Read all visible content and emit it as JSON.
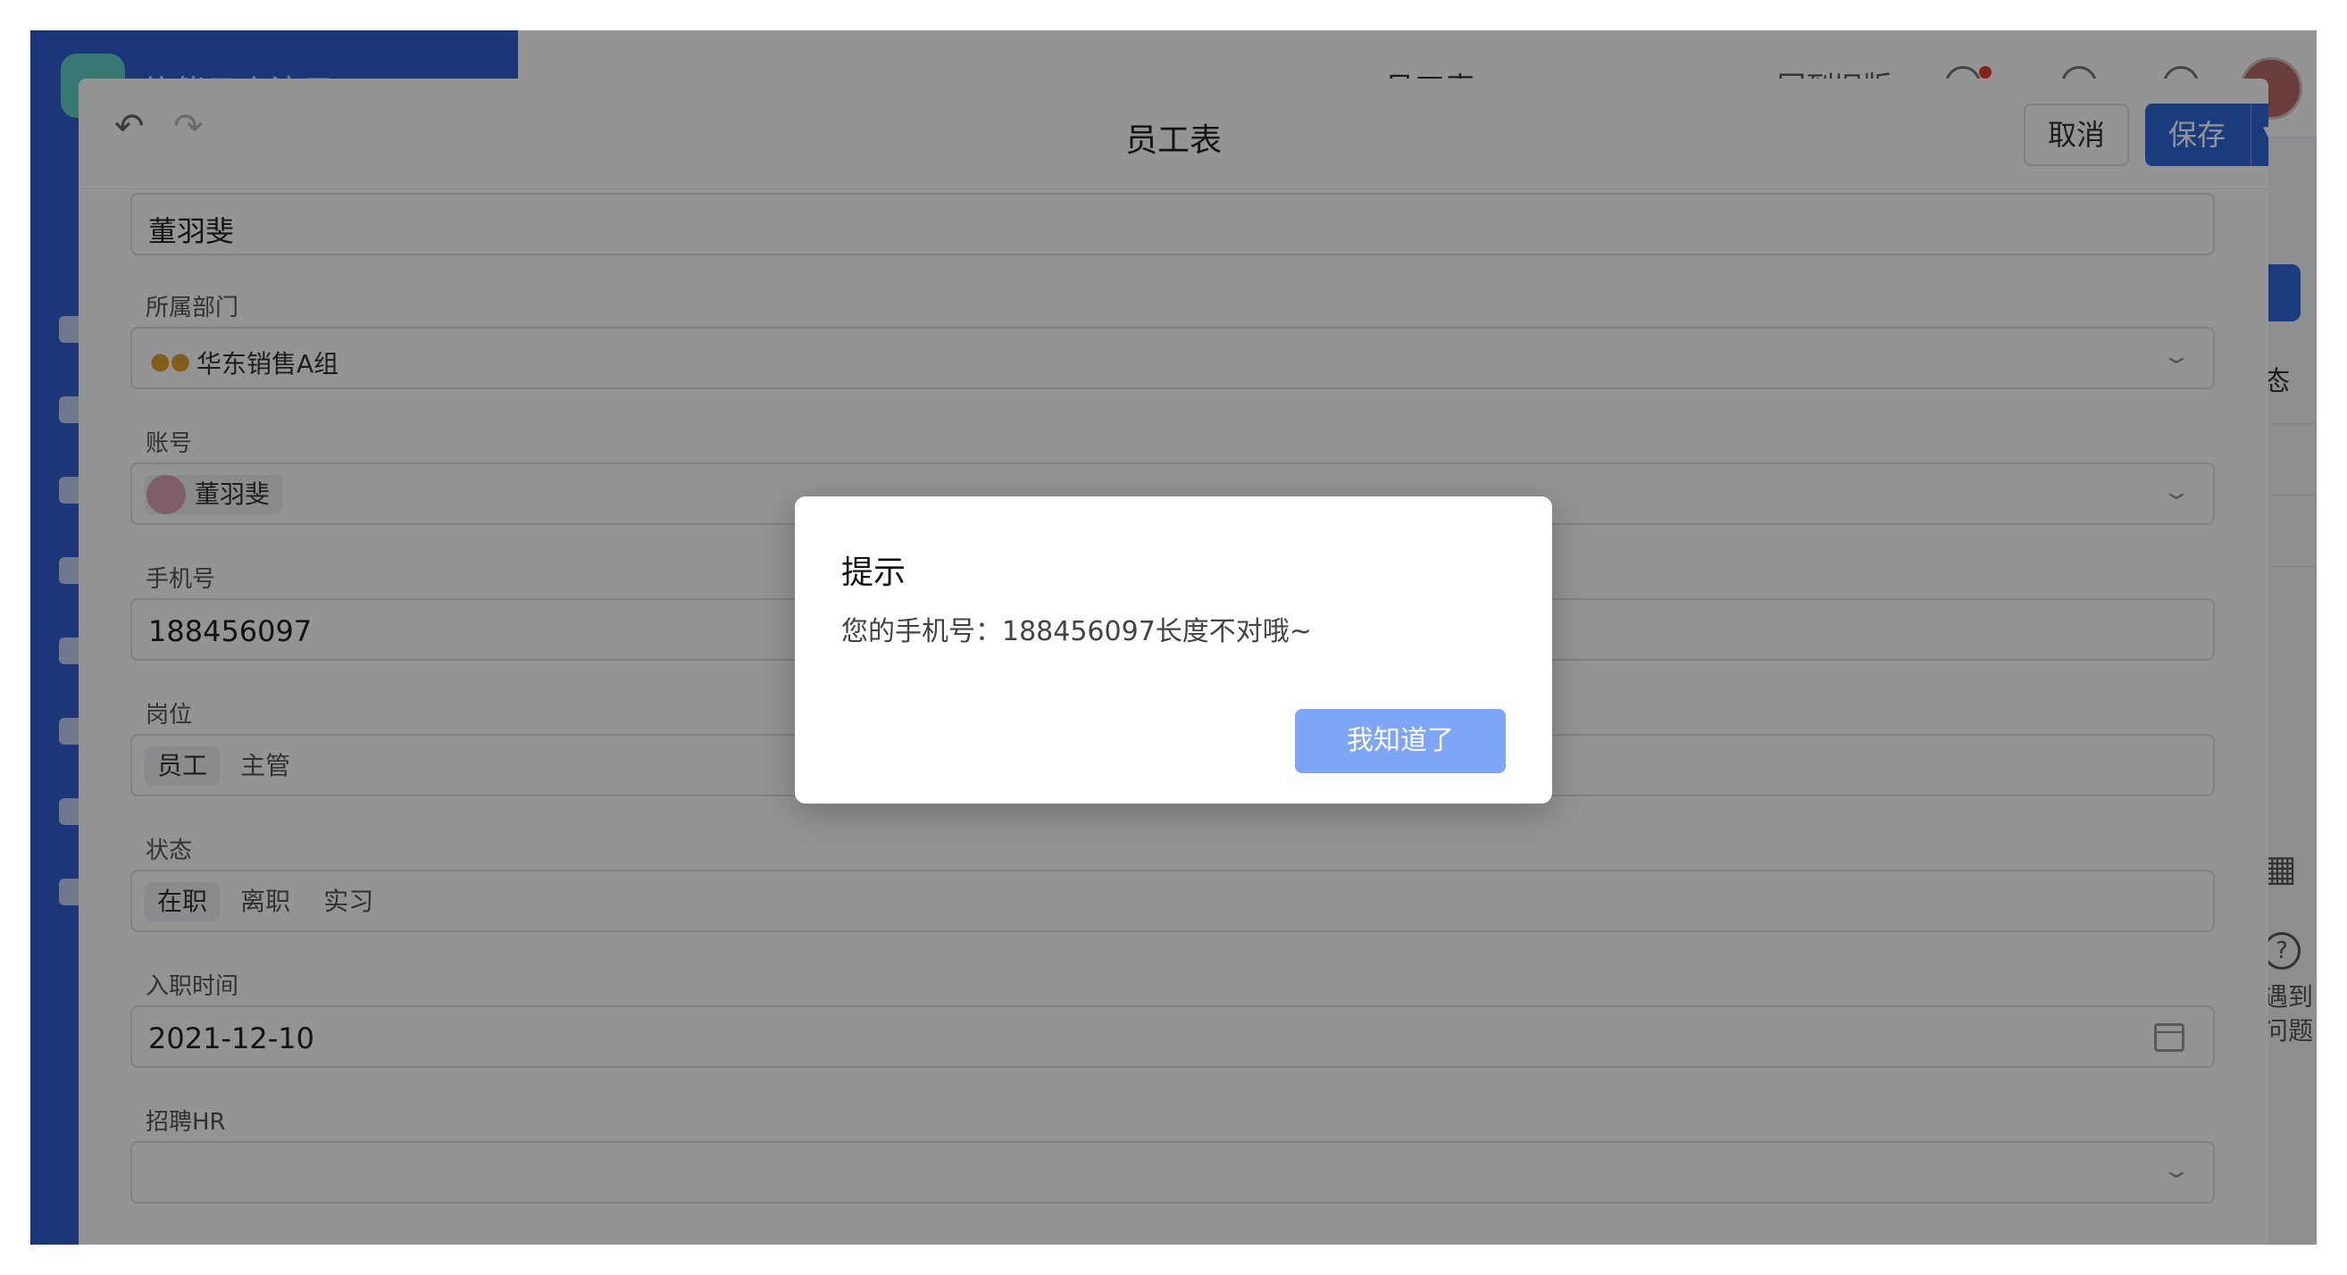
{
  "background_app": {
    "app_name": "伙伴云小演示",
    "page_title": "员工表",
    "back_link": "回到旧版",
    "right_panel_text": "态",
    "help_text": "遇到问题"
  },
  "sheet": {
    "title": "员工表",
    "cancel_label": "取消",
    "save_label": "保存",
    "fields": {
      "name": {
        "value": "董羽斐"
      },
      "department": {
        "label": "所属部门",
        "value": "华东销售A组"
      },
      "account": {
        "label": "账号",
        "value": "董羽斐"
      },
      "phone": {
        "label": "手机号",
        "value": "188456097"
      },
      "position": {
        "label": "岗位",
        "options": [
          "员工",
          "主管"
        ],
        "selected": "员工"
      },
      "status": {
        "label": "状态",
        "options": [
          "在职",
          "离职",
          "实习"
        ],
        "selected": "在职"
      },
      "hire_date": {
        "label": "入职时间",
        "value": "2021-12-10"
      },
      "recruiter": {
        "label": "招聘HR",
        "value": ""
      }
    }
  },
  "dialog": {
    "title": "提示",
    "message": "您的手机号：188456097长度不对哦~",
    "confirm_label": "我知道了"
  },
  "colors": {
    "primary": "#2f66db",
    "dialog_button": "#7ea5f8",
    "sidebar": "#2f5fd0",
    "overlay": "rgba(0,0,0,0.42)"
  }
}
